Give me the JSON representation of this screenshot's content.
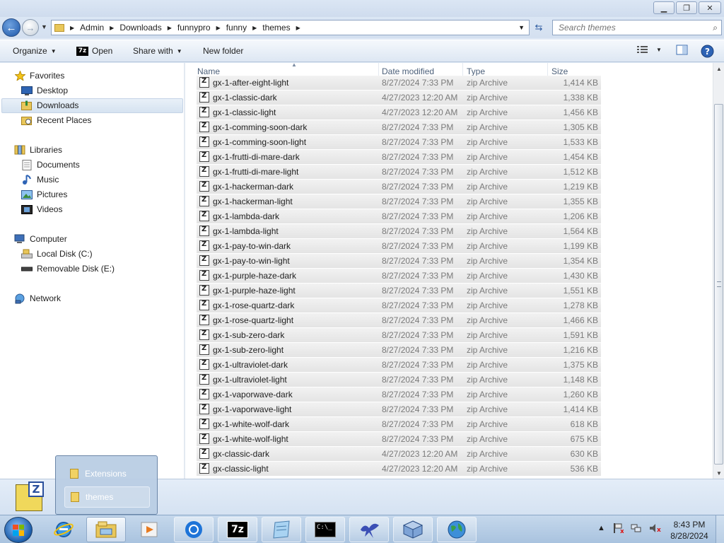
{
  "window": {
    "minimize_glyph": "▁",
    "maximize_glyph": "❐",
    "close_glyph": "✕"
  },
  "address": {
    "breadcrumbs": [
      "Admin",
      "Downloads",
      "funnypro",
      "funny",
      "themes"
    ]
  },
  "search": {
    "placeholder": "Search themes"
  },
  "toolbar": {
    "organize": "Organize",
    "open": "Open",
    "open_icon_text": "7z",
    "share_with": "Share with",
    "new_folder": "New folder"
  },
  "nav": {
    "favorites": "Favorites",
    "desktop": "Desktop",
    "downloads": "Downloads",
    "recent_places": "Recent Places",
    "libraries": "Libraries",
    "documents": "Documents",
    "music": "Music",
    "pictures": "Pictures",
    "videos": "Videos",
    "computer": "Computer",
    "local_disk": "Local Disk (C:)",
    "removable_disk": "Removable Disk (E:)",
    "network": "Network"
  },
  "columns": {
    "name": "Name",
    "date_modified": "Date modified",
    "type": "Type",
    "size": "Size"
  },
  "files": [
    {
      "name": "gx-1-after-eight-light",
      "date": "8/27/2024 7:33 PM",
      "type": "zip Archive",
      "size": "1,414 KB"
    },
    {
      "name": "gx-1-classic-dark",
      "date": "4/27/2023 12:20 AM",
      "type": "zip Archive",
      "size": "1,338 KB"
    },
    {
      "name": "gx-1-classic-light",
      "date": "4/27/2023 12:20 AM",
      "type": "zip Archive",
      "size": "1,456 KB"
    },
    {
      "name": "gx-1-comming-soon-dark",
      "date": "8/27/2024 7:33 PM",
      "type": "zip Archive",
      "size": "1,305 KB"
    },
    {
      "name": "gx-1-comming-soon-light",
      "date": "8/27/2024 7:33 PM",
      "type": "zip Archive",
      "size": "1,533 KB"
    },
    {
      "name": "gx-1-frutti-di-mare-dark",
      "date": "8/27/2024 7:33 PM",
      "type": "zip Archive",
      "size": "1,454 KB"
    },
    {
      "name": "gx-1-frutti-di-mare-light",
      "date": "8/27/2024 7:33 PM",
      "type": "zip Archive",
      "size": "1,512 KB"
    },
    {
      "name": "gx-1-hackerman-dark",
      "date": "8/27/2024 7:33 PM",
      "type": "zip Archive",
      "size": "1,219 KB"
    },
    {
      "name": "gx-1-hackerman-light",
      "date": "8/27/2024 7:33 PM",
      "type": "zip Archive",
      "size": "1,355 KB"
    },
    {
      "name": "gx-1-lambda-dark",
      "date": "8/27/2024 7:33 PM",
      "type": "zip Archive",
      "size": "1,206 KB"
    },
    {
      "name": "gx-1-lambda-light",
      "date": "8/27/2024 7:33 PM",
      "type": "zip Archive",
      "size": "1,564 KB"
    },
    {
      "name": "gx-1-pay-to-win-dark",
      "date": "8/27/2024 7:33 PM",
      "type": "zip Archive",
      "size": "1,199 KB"
    },
    {
      "name": "gx-1-pay-to-win-light",
      "date": "8/27/2024 7:33 PM",
      "type": "zip Archive",
      "size": "1,354 KB"
    },
    {
      "name": "gx-1-purple-haze-dark",
      "date": "8/27/2024 7:33 PM",
      "type": "zip Archive",
      "size": "1,430 KB"
    },
    {
      "name": "gx-1-purple-haze-light",
      "date": "8/27/2024 7:33 PM",
      "type": "zip Archive",
      "size": "1,551 KB"
    },
    {
      "name": "gx-1-rose-quartz-dark",
      "date": "8/27/2024 7:33 PM",
      "type": "zip Archive",
      "size": "1,278 KB"
    },
    {
      "name": "gx-1-rose-quartz-light",
      "date": "8/27/2024 7:33 PM",
      "type": "zip Archive",
      "size": "1,466 KB"
    },
    {
      "name": "gx-1-sub-zero-dark",
      "date": "8/27/2024 7:33 PM",
      "type": "zip Archive",
      "size": "1,591 KB"
    },
    {
      "name": "gx-1-sub-zero-light",
      "date": "8/27/2024 7:33 PM",
      "type": "zip Archive",
      "size": "1,216 KB"
    },
    {
      "name": "gx-1-ultraviolet-dark",
      "date": "8/27/2024 7:33 PM",
      "type": "zip Archive",
      "size": "1,375 KB"
    },
    {
      "name": "gx-1-ultraviolet-light",
      "date": "8/27/2024 7:33 PM",
      "type": "zip Archive",
      "size": "1,148 KB"
    },
    {
      "name": "gx-1-vaporwave-dark",
      "date": "8/27/2024 7:33 PM",
      "type": "zip Archive",
      "size": "1,260 KB"
    },
    {
      "name": "gx-1-vaporwave-light",
      "date": "8/27/2024 7:33 PM",
      "type": "zip Archive",
      "size": "1,414 KB"
    },
    {
      "name": "gx-1-white-wolf-dark",
      "date": "8/27/2024 7:33 PM",
      "type": "zip Archive",
      "size": "618 KB"
    },
    {
      "name": "gx-1-white-wolf-light",
      "date": "8/27/2024 7:33 PM",
      "type": "zip Archive",
      "size": "675 KB"
    },
    {
      "name": "gx-classic-dark",
      "date": "4/27/2023 12:20 AM",
      "type": "zip Archive",
      "size": "630 KB"
    },
    {
      "name": "gx-classic-light",
      "date": "4/27/2023 12:20 AM",
      "type": "zip Archive",
      "size": "536 KB"
    }
  ],
  "jumplist": {
    "items": [
      "Extensions",
      "themes"
    ]
  },
  "taskbar": {
    "sevenzip_label": "7z",
    "cmd_label": "C:\\_"
  },
  "clock": {
    "time": "8:43 PM",
    "date": "8/28/2024"
  },
  "colors": {
    "accent": "#1c56a8",
    "selected_nav": "#d6e3f1"
  }
}
